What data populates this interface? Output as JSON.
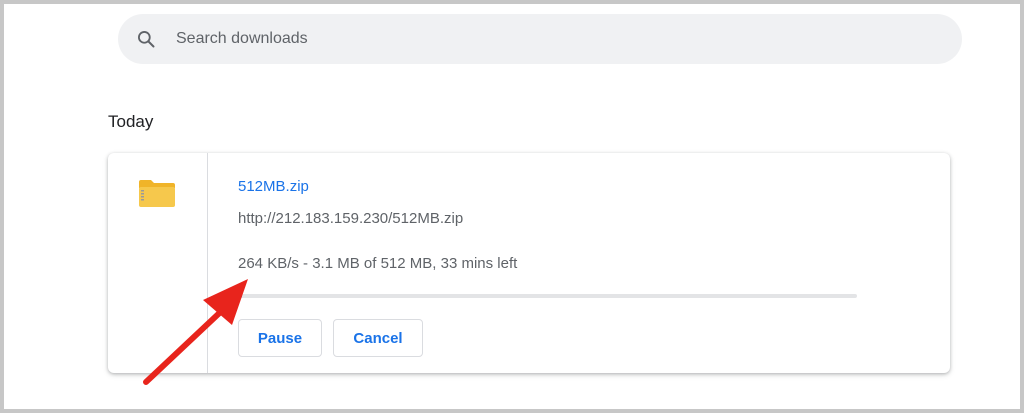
{
  "search": {
    "placeholder": "Search downloads",
    "icon": "search-icon"
  },
  "section": {
    "title": "Today"
  },
  "download": {
    "icon": "zip-folder-icon",
    "file_name": "512MB.zip",
    "url": "http://212.183.159.230/512MB.zip",
    "status": "264 KB/s - 3.1 MB of 512 MB, 33 mins left",
    "progress_fraction": 0.006,
    "pause_label": "Pause",
    "cancel_label": "Cancel"
  },
  "annotation": {
    "icon": "red-arrow-icon",
    "color": "#e8241c"
  },
  "colors": {
    "accent": "#1a73e8",
    "folder": "#f6c84c",
    "muted_text": "#5f6368"
  }
}
